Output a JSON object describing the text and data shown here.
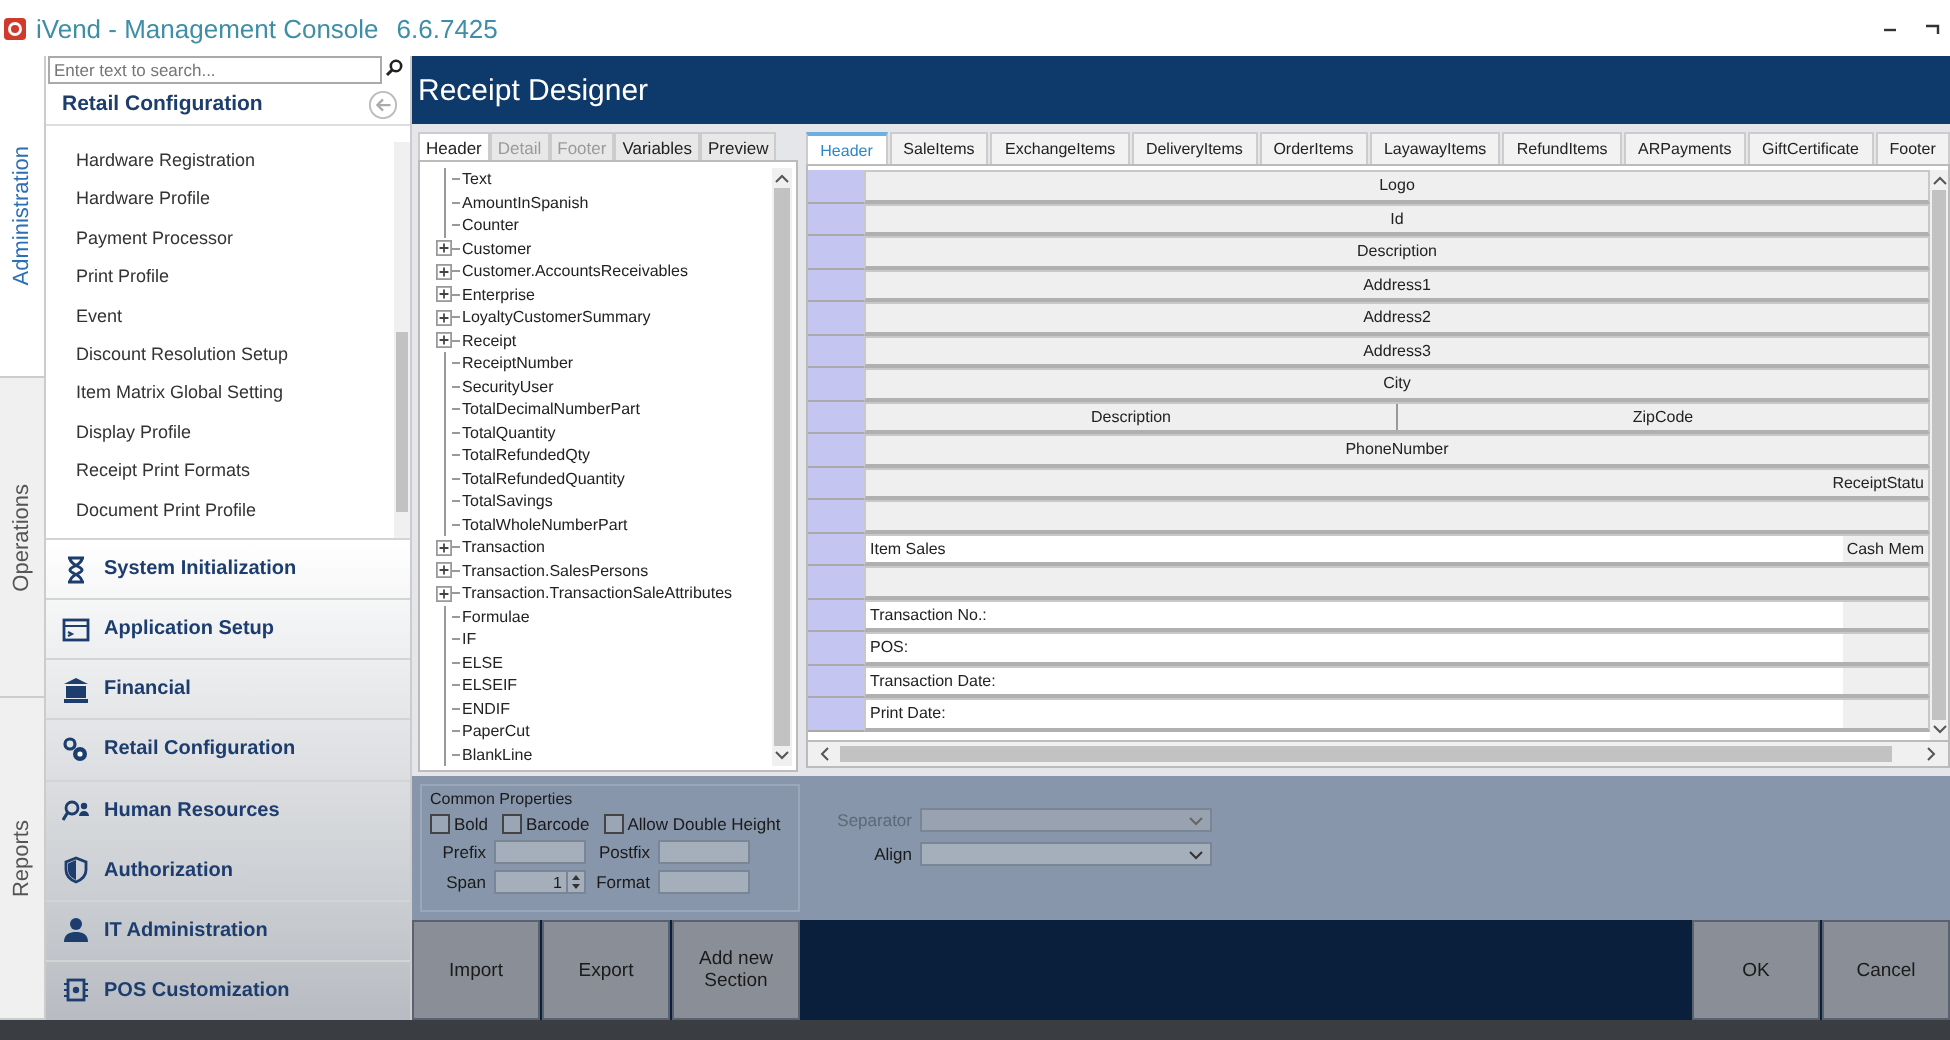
{
  "window": {
    "title": "iVend - Management Console",
    "version": "6.6.7425"
  },
  "side_tabs": [
    {
      "label": "Administration",
      "selected": true
    },
    {
      "label": "Operations",
      "selected": false
    },
    {
      "label": "Reports",
      "selected": false
    }
  ],
  "nav": {
    "search": {
      "placeholder": "Enter text to search..."
    },
    "heading": "Retail Configuration",
    "items": [
      "Hardware Registration",
      "Hardware Profile",
      "Payment Processor",
      "Print Profile",
      "Event",
      "Discount Resolution Setup",
      "Item Matrix Global Setting",
      "Display Profile",
      "Receipt Print Formats",
      "Document Print Profile"
    ],
    "categories": [
      "System Initialization",
      "Application Setup",
      "Financial",
      "Retail Configuration",
      "Human Resources",
      "Authorization",
      "IT Administration",
      "POS Customization"
    ]
  },
  "designer": {
    "title": "Receipt Designer",
    "left_tabs": [
      {
        "label": "Header",
        "selected": true,
        "disabled": false
      },
      {
        "label": "Detail",
        "selected": false,
        "disabled": true
      },
      {
        "label": "Footer",
        "selected": false,
        "disabled": true
      },
      {
        "label": "Variables",
        "selected": false,
        "disabled": false
      },
      {
        "label": "Preview",
        "selected": false,
        "disabled": false
      }
    ],
    "tree": [
      {
        "label": "Text",
        "kind": "leaf"
      },
      {
        "label": "AmountInSpanish",
        "kind": "leaf"
      },
      {
        "label": "Counter",
        "kind": "leaf"
      },
      {
        "label": "Customer",
        "kind": "group"
      },
      {
        "label": "Customer.AccountsReceivables",
        "kind": "group"
      },
      {
        "label": "Enterprise",
        "kind": "group"
      },
      {
        "label": "LoyaltyCustomerSummary",
        "kind": "group"
      },
      {
        "label": "Receipt",
        "kind": "group"
      },
      {
        "label": "ReceiptNumber",
        "kind": "leaf"
      },
      {
        "label": "SecurityUser",
        "kind": "leaf"
      },
      {
        "label": "TotalDecimalNumberPart",
        "kind": "leaf"
      },
      {
        "label": "TotalQuantity",
        "kind": "leaf"
      },
      {
        "label": "TotalRefundedQty",
        "kind": "leaf"
      },
      {
        "label": "TotalRefundedQuantity",
        "kind": "leaf"
      },
      {
        "label": "TotalSavings",
        "kind": "leaf"
      },
      {
        "label": "TotalWholeNumberPart",
        "kind": "leaf"
      },
      {
        "label": "Transaction",
        "kind": "group"
      },
      {
        "label": "Transaction.SalesPersons",
        "kind": "group"
      },
      {
        "label": "Transaction.TransactionSaleAttributes",
        "kind": "group"
      },
      {
        "label": "Formulae",
        "kind": "leaf"
      },
      {
        "label": "IF",
        "kind": "leaf"
      },
      {
        "label": "ELSE",
        "kind": "leaf"
      },
      {
        "label": "ELSEIF",
        "kind": "leaf"
      },
      {
        "label": "ENDIF",
        "kind": "leaf"
      },
      {
        "label": "PaperCut",
        "kind": "leaf"
      },
      {
        "label": "BlankLine",
        "kind": "leaf"
      }
    ],
    "section_tabs": [
      {
        "label": "Header",
        "selected": true
      },
      {
        "label": "SaleItems",
        "selected": false
      },
      {
        "label": "ExchangeItems",
        "selected": false
      },
      {
        "label": "DeliveryItems",
        "selected": false
      },
      {
        "label": "OrderItems",
        "selected": false
      },
      {
        "label": "LayawayItems",
        "selected": false
      },
      {
        "label": "RefundItems",
        "selected": false
      },
      {
        "label": "ARPayments",
        "selected": false
      },
      {
        "label": "GiftCertificate",
        "selected": false
      },
      {
        "label": "Footer",
        "selected": false
      }
    ],
    "rows": [
      {
        "kind": "centered",
        "cells": [
          "Logo"
        ]
      },
      {
        "kind": "centered",
        "cells": [
          "Id"
        ]
      },
      {
        "kind": "centered",
        "cells": [
          "Description"
        ]
      },
      {
        "kind": "centered",
        "cells": [
          "Address1"
        ]
      },
      {
        "kind": "centered",
        "cells": [
          "Address2"
        ]
      },
      {
        "kind": "centered",
        "cells": [
          "Address3"
        ]
      },
      {
        "kind": "centered",
        "cells": [
          "City"
        ]
      },
      {
        "kind": "centered",
        "cells": [
          "Description",
          "ZipCode"
        ]
      },
      {
        "kind": "centered",
        "cells": [
          "PhoneNumber"
        ]
      },
      {
        "kind": "right",
        "cells": [
          "ReceiptStatu"
        ]
      },
      {
        "kind": "blank"
      },
      {
        "kind": "text",
        "cells": [
          "Item Sales",
          "Cash Mem"
        ]
      },
      {
        "kind": "blank"
      },
      {
        "kind": "text",
        "cells": [
          "Transaction No.:"
        ]
      },
      {
        "kind": "text",
        "cells": [
          "POS:"
        ]
      },
      {
        "kind": "text",
        "cells": [
          "Transaction Date:"
        ]
      },
      {
        "kind": "text",
        "cells": [
          "Print Date:"
        ]
      }
    ],
    "properties": {
      "title": "Common Properties",
      "checkboxes": [
        {
          "label": "Bold",
          "checked": false
        },
        {
          "label": "Barcode",
          "checked": false
        },
        {
          "label": "Allow Double Height",
          "checked": false
        }
      ],
      "prefix": {
        "label": "Prefix"
      },
      "postfix": {
        "label": "Postfix"
      },
      "span": {
        "label": "Span",
        "value": "1"
      },
      "format": {
        "label": "Format"
      },
      "separator": {
        "label": "Separator",
        "disabled": true
      },
      "align": {
        "label": "Align",
        "disabled": false
      }
    },
    "left_buttons": [
      "Import",
      "Export",
      "Add new Section"
    ],
    "right_buttons": [
      "OK",
      "Cancel"
    ]
  }
}
